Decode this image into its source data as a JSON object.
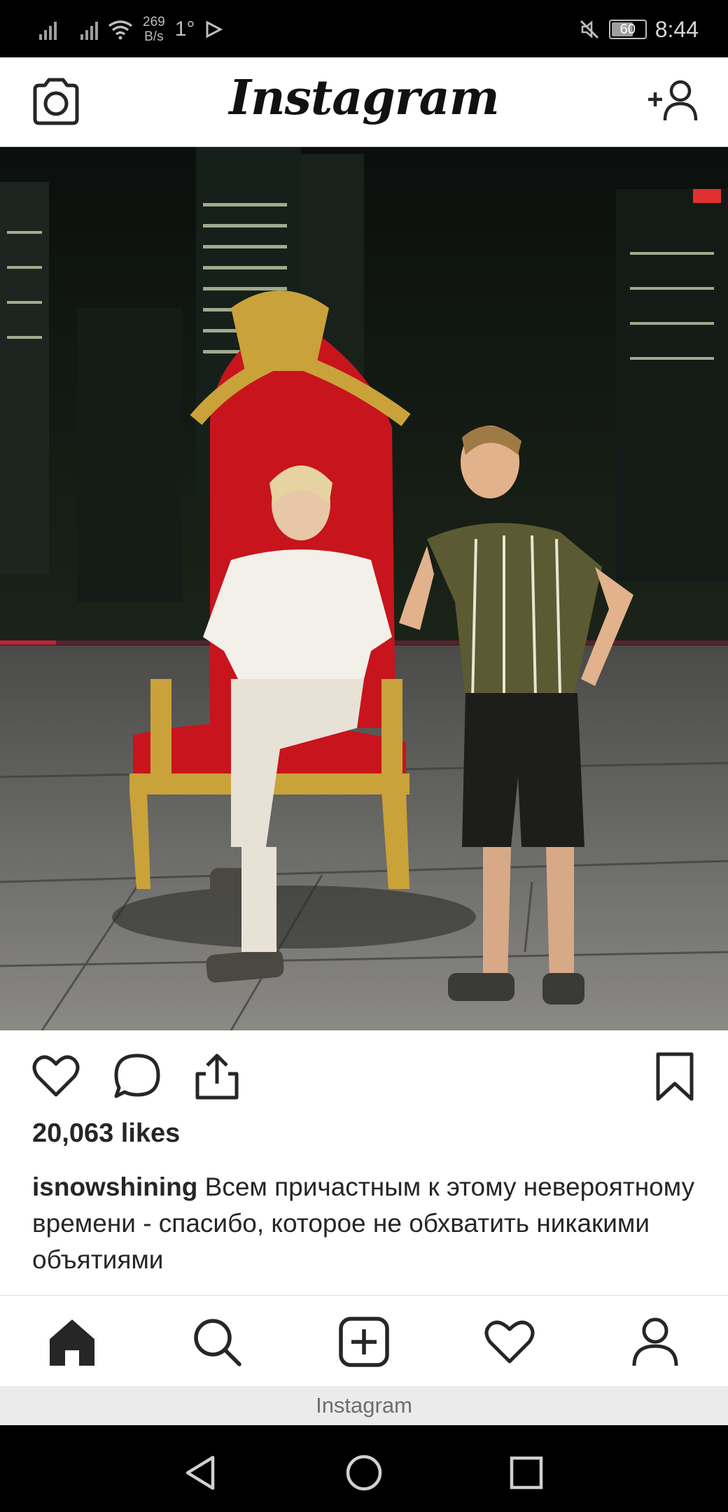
{
  "status_bar": {
    "net_speed_value": "269",
    "net_speed_unit": "B/s",
    "temperature": "1°",
    "battery_level": "60",
    "time": "8:44",
    "icons": [
      "signal-icon",
      "signal-icon",
      "wifi-icon",
      "play-icon",
      "mute-icon",
      "battery-icon"
    ]
  },
  "header": {
    "logo": "Instagram",
    "icons": [
      "camera-icon",
      "add-user-icon"
    ]
  },
  "post": {
    "image_icon": "post-photo",
    "actions": [
      "heart-icon",
      "comment-icon",
      "share-icon",
      "bookmark-icon"
    ],
    "likes": "20,063 likes",
    "username": "isnowshining",
    "caption": "Всем причастным к этому невероятному времени - спасибо, которое не обхватить никакими объятиями"
  },
  "tabbar": {
    "items": [
      "home-icon",
      "search-icon",
      "new-post-icon",
      "activity-icon",
      "profile-icon"
    ],
    "app_label": "Instagram"
  },
  "android_nav": {
    "items": [
      "back-icon",
      "home-circle-icon",
      "recents-icon"
    ]
  },
  "colors": {
    "text": "#262626",
    "divider": "#dbdbdb",
    "throne_red": "#c8141c",
    "gold": "#c9a23a"
  }
}
